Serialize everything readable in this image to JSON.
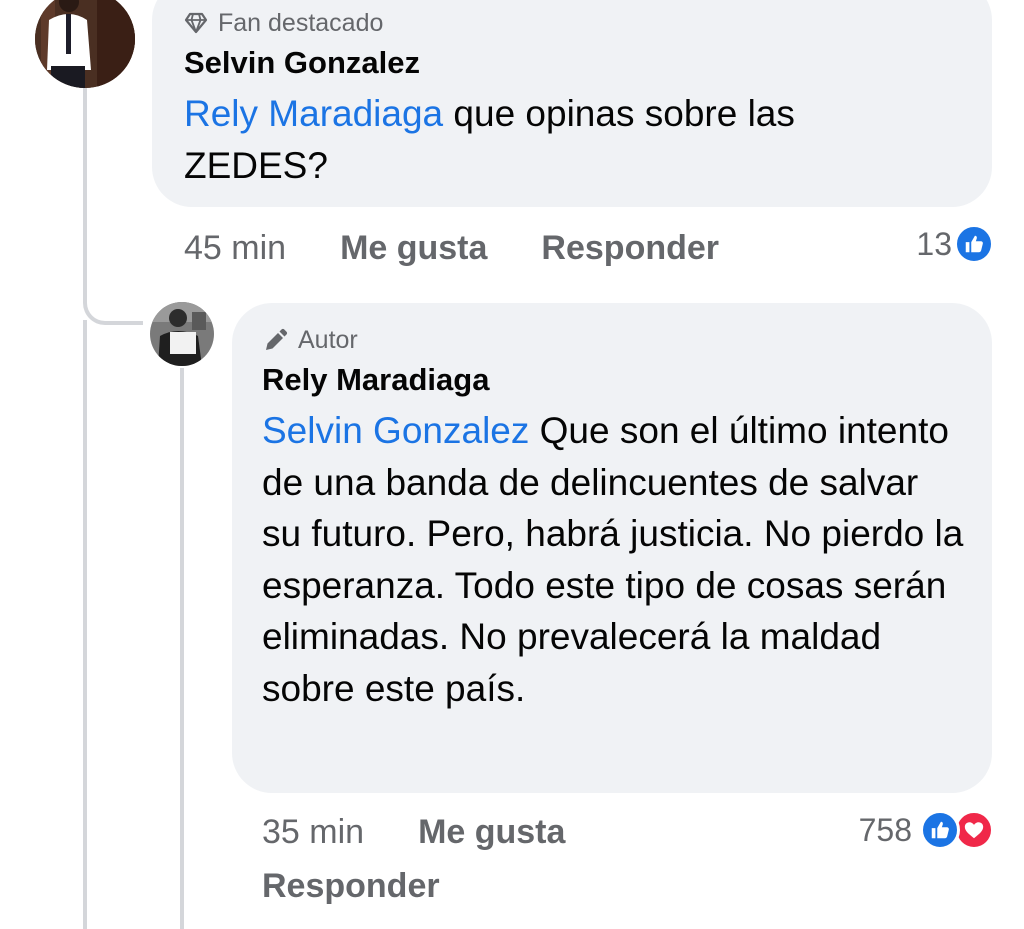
{
  "comment1": {
    "badge": "Fan destacado",
    "author": "Selvin Gonzalez",
    "mention": "Rely Maradiaga",
    "text": " que opinas sobre las ZEDES?",
    "time": "45 min",
    "like_label": "Me gusta",
    "reply_label": "Responder",
    "reaction_count": "13",
    "reactions": [
      "like-icon"
    ],
    "colors": {
      "like": "#1b74e4"
    }
  },
  "comment2": {
    "badge": "Autor",
    "author": "Rely Maradiaga",
    "mention": "Selvin Gonzalez",
    "text": " Que son el último intento de una banda de delincuentes de salvar su futuro. Pero, habrá justicia. No pierdo la esperanza. Todo este tipo de cosas serán eliminadas. No prevalecerá la maldad sobre este país.",
    "time": "35 min",
    "like_label": "Me gusta",
    "reply_label": "Responder",
    "reaction_count": "758",
    "reactions": [
      "like-icon",
      "love-icon"
    ],
    "colors": {
      "like": "#1b74e4",
      "love": "#f02849"
    }
  }
}
